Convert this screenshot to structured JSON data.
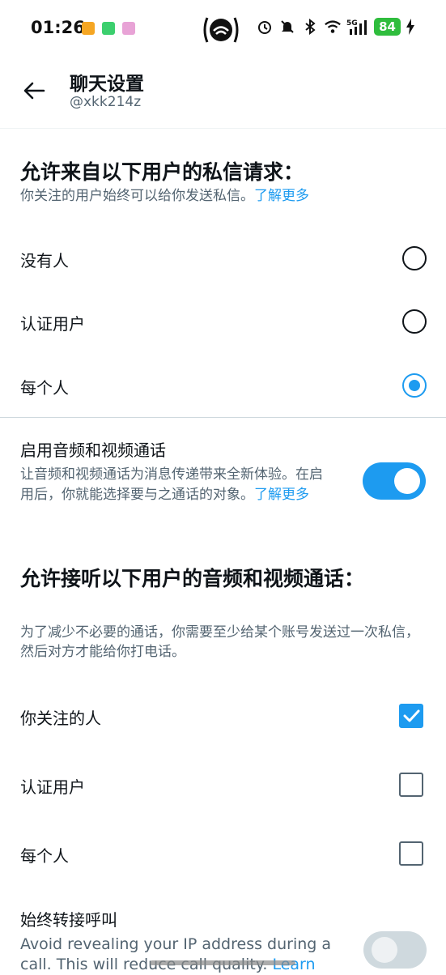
{
  "status_bar": {
    "time": "01:26",
    "battery": "84",
    "network": "5G"
  },
  "header": {
    "title": "聊天设置",
    "username": "@xkk214z"
  },
  "dm_section": {
    "title": "允许来自以下用户的私信请求：",
    "desc": "你关注的用户始终可以给你发送私信。",
    "learn_more": "了解更多",
    "options": [
      "没有人",
      "认证用户",
      "每个人"
    ],
    "selected": "每个人"
  },
  "av_calls": {
    "label": "启用音频和视频通话",
    "desc": "让音频和视频通话为消息传递带来全新体验。在启用后，你就能选择要与之通话的对象。",
    "learn_more": "了解更多",
    "enabled": true
  },
  "calls_section": {
    "title": "允许接听以下用户的音频和视频通话：",
    "desc": "为了减少不必要的通话，你需要至少给某个账号发送过一次私信，然后对方才能给你打电话。",
    "options": [
      {
        "label": "你关注的人",
        "checked": true
      },
      {
        "label": "认证用户",
        "checked": false
      },
      {
        "label": "每个人",
        "checked": false
      }
    ]
  },
  "relay": {
    "label": "始终转接呼叫",
    "desc": "Avoid revealing your IP address during a call. This will reduce call quality.",
    "learn_more": "Learn",
    "enabled": false
  },
  "colors": {
    "accent": "#1d9bf0",
    "text": "#0f1419",
    "secondary": "#536471"
  }
}
